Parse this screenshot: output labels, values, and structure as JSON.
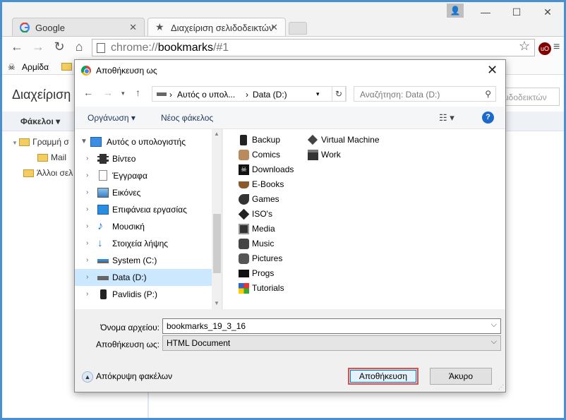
{
  "browser": {
    "tabs": [
      {
        "title": "Google",
        "icon": "google-g-icon"
      },
      {
        "title": "Διαχείριση σελιδοδεικτών",
        "icon": "star-icon"
      }
    ],
    "address": {
      "scheme": "chrome://",
      "host": "bookmarks",
      "path": "/#1"
    },
    "bookmarks_bar": [
      {
        "label": "Αρμίδα",
        "icon": "pirate-icon"
      }
    ]
  },
  "bookmark_manager": {
    "heading": "Διαχείριση",
    "search_placeholder": "λιδοδεικτών",
    "folders_menu": "Φάκελοι",
    "tree": [
      {
        "label": "Γραμμή σ"
      },
      {
        "label": "Mail"
      },
      {
        "label": "Άλλοι σελ"
      }
    ]
  },
  "dialog": {
    "title": "Αποθήκευση ως",
    "breadcrumb": [
      "Αυτός ο υπολ...",
      "Data (D:)"
    ],
    "search_placeholder": "Αναζήτηση: Data (D:)",
    "commands": {
      "organize": "Οργάνωση",
      "new_folder": "Νέος φάκελος"
    },
    "nav_root": "Αυτός ο υπολογιστής",
    "nav_items": [
      {
        "label": "Βίντεο",
        "icon": "film-icon"
      },
      {
        "label": "Έγγραφα",
        "icon": "document-icon"
      },
      {
        "label": "Εικόνες",
        "icon": "pictures-icon"
      },
      {
        "label": "Επιφάνεια εργασίας",
        "icon": "desktop-icon"
      },
      {
        "label": "Μουσική",
        "icon": "music-note-icon"
      },
      {
        "label": "Στοιχεία λήψης",
        "icon": "download-arrow-icon"
      },
      {
        "label": "System (C:)",
        "icon": "system-drive-icon"
      },
      {
        "label": "Data (D:)",
        "icon": "drive-icon",
        "selected": true
      },
      {
        "label": "Pavlidis (P:)",
        "icon": "phone-icon"
      }
    ],
    "files_col1": [
      "Backup",
      "Comics",
      "Downloads",
      "E-Books",
      "Games",
      "ISO's",
      "Media",
      "Music",
      "Pictures",
      "Progs",
      "Tutorials"
    ],
    "files_col2": [
      "Virtual Machine",
      "Work"
    ],
    "filename_label": "Όνομα αρχείου:",
    "filename_value": "bookmarks_19_3_16",
    "savetype_label": "Αποθήκευση ως:",
    "savetype_value": "HTML Document",
    "hide_folders": "Απόκρυψη φακέλων",
    "save_button": "Αποθήκευση",
    "cancel_button": "Άκυρο",
    "highlight_color": "#d9534f"
  }
}
